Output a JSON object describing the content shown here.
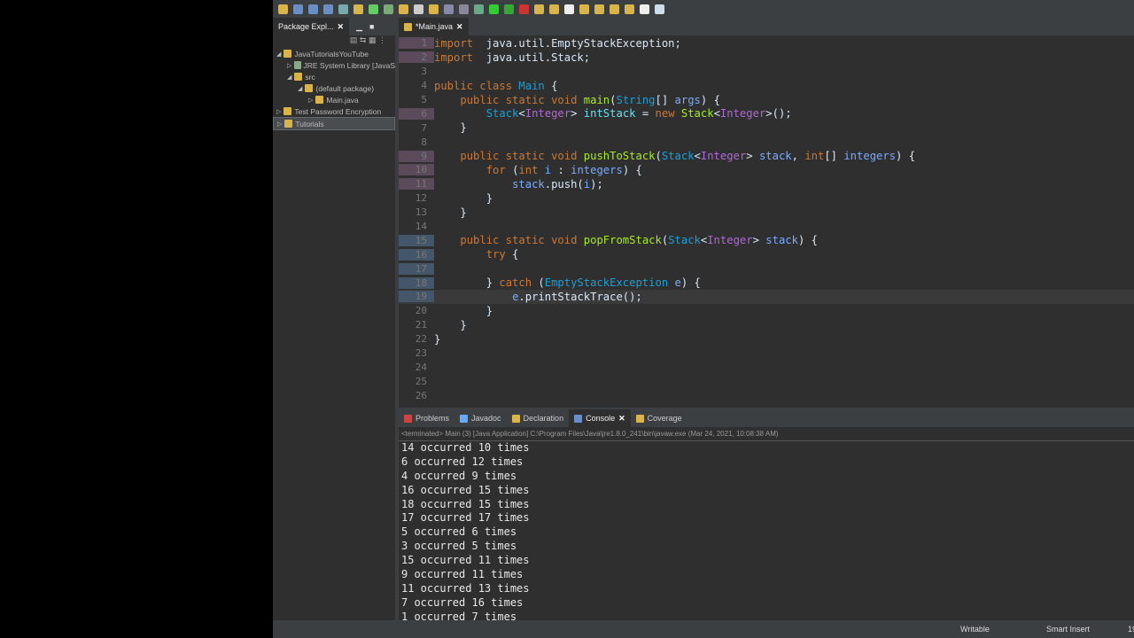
{
  "package_explorer": {
    "title": "Package Expl...",
    "items": [
      {
        "label": "JavaTutorialsYouTube",
        "depth": 0,
        "arrow": "◢"
      },
      {
        "label": "JRE System Library [JavaS",
        "depth": 1,
        "arrow": "▷"
      },
      {
        "label": "src",
        "depth": 1,
        "arrow": "◢"
      },
      {
        "label": "(default package)",
        "depth": 2,
        "arrow": "◢"
      },
      {
        "label": "Main.java",
        "depth": 3,
        "arrow": "▷"
      },
      {
        "label": "Test Password Encryption",
        "depth": 0,
        "arrow": "▷"
      },
      {
        "label": "Tutorials",
        "depth": 0,
        "arrow": "▷"
      }
    ]
  },
  "editor": {
    "tab": "*Main.java"
  },
  "code": {
    "lines": [
      {
        "n": "1",
        "t": [
          [
            "kw",
            "import"
          ],
          [
            "",
            "  java.util.EmptyStackException;"
          ]
        ]
      },
      {
        "n": "2",
        "t": [
          [
            "kw",
            "import"
          ],
          [
            "",
            "  java.util.Stack;"
          ]
        ]
      },
      {
        "n": "3",
        "t": []
      },
      {
        "n": "4",
        "t": [
          [
            "kw",
            "public class "
          ],
          [
            "ty",
            "Main"
          ],
          [
            "",
            " {"
          ]
        ]
      },
      {
        "n": "5",
        "t": [
          [
            "",
            "    "
          ],
          [
            "kw",
            "public static void "
          ],
          [
            "me",
            "main"
          ],
          [
            "",
            "("
          ],
          [
            "ty",
            "String"
          ],
          [
            "",
            "[] "
          ],
          [
            "va",
            "args"
          ],
          [
            "",
            ") {"
          ]
        ]
      },
      {
        "n": "6",
        "t": [
          [
            "",
            "        "
          ],
          [
            "ty",
            "Stack"
          ],
          [
            "",
            "<"
          ],
          [
            "gen",
            "Integer"
          ],
          [
            "",
            "> "
          ],
          [
            "fi",
            "intStack"
          ],
          [
            "",
            " = "
          ],
          [
            "kw",
            "new "
          ],
          [
            "me",
            "Stack"
          ],
          [
            "",
            "<"
          ],
          [
            "gen",
            "Integer"
          ],
          [
            "",
            ">();"
          ]
        ]
      },
      {
        "n": "7",
        "t": [
          [
            "",
            "    }"
          ]
        ]
      },
      {
        "n": "8",
        "t": []
      },
      {
        "n": "9",
        "t": [
          [
            "",
            "    "
          ],
          [
            "kw",
            "public static void "
          ],
          [
            "me",
            "pushToStack"
          ],
          [
            "",
            "("
          ],
          [
            "ty",
            "Stack"
          ],
          [
            "",
            "<"
          ],
          [
            "gen",
            "Integer"
          ],
          [
            "",
            "> "
          ],
          [
            "va",
            "stack"
          ],
          [
            "",
            ", "
          ],
          [
            "kw",
            "int"
          ],
          [
            "",
            "[] "
          ],
          [
            "va",
            "integers"
          ],
          [
            "",
            ") {"
          ]
        ]
      },
      {
        "n": "10",
        "t": [
          [
            "",
            "        "
          ],
          [
            "kw",
            "for "
          ],
          [
            "",
            "("
          ],
          [
            "kw",
            "int "
          ],
          [
            "va",
            "i"
          ],
          [
            "",
            " : "
          ],
          [
            "va",
            "integers"
          ],
          [
            "",
            ") {"
          ]
        ]
      },
      {
        "n": "11",
        "t": [
          [
            "",
            "            "
          ],
          [
            "va",
            "stack"
          ],
          [
            "",
            ".push("
          ],
          [
            "va",
            "i"
          ],
          [
            "",
            ");"
          ]
        ]
      },
      {
        "n": "12",
        "t": [
          [
            "",
            "        }"
          ]
        ]
      },
      {
        "n": "13",
        "t": [
          [
            "",
            "    }"
          ]
        ]
      },
      {
        "n": "14",
        "t": []
      },
      {
        "n": "15",
        "t": [
          [
            "",
            "    "
          ],
          [
            "kw",
            "public static void "
          ],
          [
            "me",
            "popFromStack"
          ],
          [
            "",
            "("
          ],
          [
            "ty",
            "Stack"
          ],
          [
            "",
            "<"
          ],
          [
            "gen",
            "Integer"
          ],
          [
            "",
            "> "
          ],
          [
            "va",
            "stack"
          ],
          [
            "",
            ") {"
          ]
        ]
      },
      {
        "n": "16",
        "t": [
          [
            "",
            "        "
          ],
          [
            "kw",
            "try"
          ],
          [
            "",
            " {"
          ]
        ]
      },
      {
        "n": "17",
        "t": []
      },
      {
        "n": "18",
        "t": [
          [
            "",
            "        } "
          ],
          [
            "kw",
            "catch "
          ],
          [
            "",
            "("
          ],
          [
            "ty",
            "EmptyStackException "
          ],
          [
            "va",
            "e"
          ],
          [
            "",
            ") {"
          ]
        ]
      },
      {
        "n": "19",
        "t": [
          [
            "",
            "            "
          ],
          [
            "va",
            "e"
          ],
          [
            "",
            ".printStackTrace();"
          ]
        ]
      },
      {
        "n": "20",
        "t": [
          [
            "",
            "        }"
          ]
        ]
      },
      {
        "n": "21",
        "t": [
          [
            "",
            "    }"
          ]
        ]
      },
      {
        "n": "22",
        "t": [
          [
            "",
            "}"
          ]
        ]
      },
      {
        "n": "23",
        "t": []
      },
      {
        "n": "24",
        "t": []
      },
      {
        "n": "25",
        "t": []
      },
      {
        "n": "26",
        "t": []
      }
    ]
  },
  "console": {
    "tabs": [
      "Problems",
      "Javadoc",
      "Declaration",
      "Console",
      "Coverage"
    ],
    "meta": "<terminated> Main (3) [Java Application] C:\\Program Files\\Java\\jre1.8.0_241\\bin\\javaw.exe (Mar 24, 2021, 10:08:38 AM)",
    "lines": [
      "14 occurred 10 times",
      "6 occurred 12 times",
      "4 occurred 9 times",
      "16 occurred 15 times",
      "18 occurred 15 times",
      "17 occurred 17 times",
      "5 occurred 6 times",
      "3 occurred 5 times",
      "15 occurred 11 times",
      "9 occurred 11 times",
      "11 occurred 13 times",
      "7 occurred 16 times",
      "1 occurred 7 times"
    ]
  },
  "status": {
    "writable": "Writable",
    "insert": "Smart Insert",
    "pos": "19"
  }
}
